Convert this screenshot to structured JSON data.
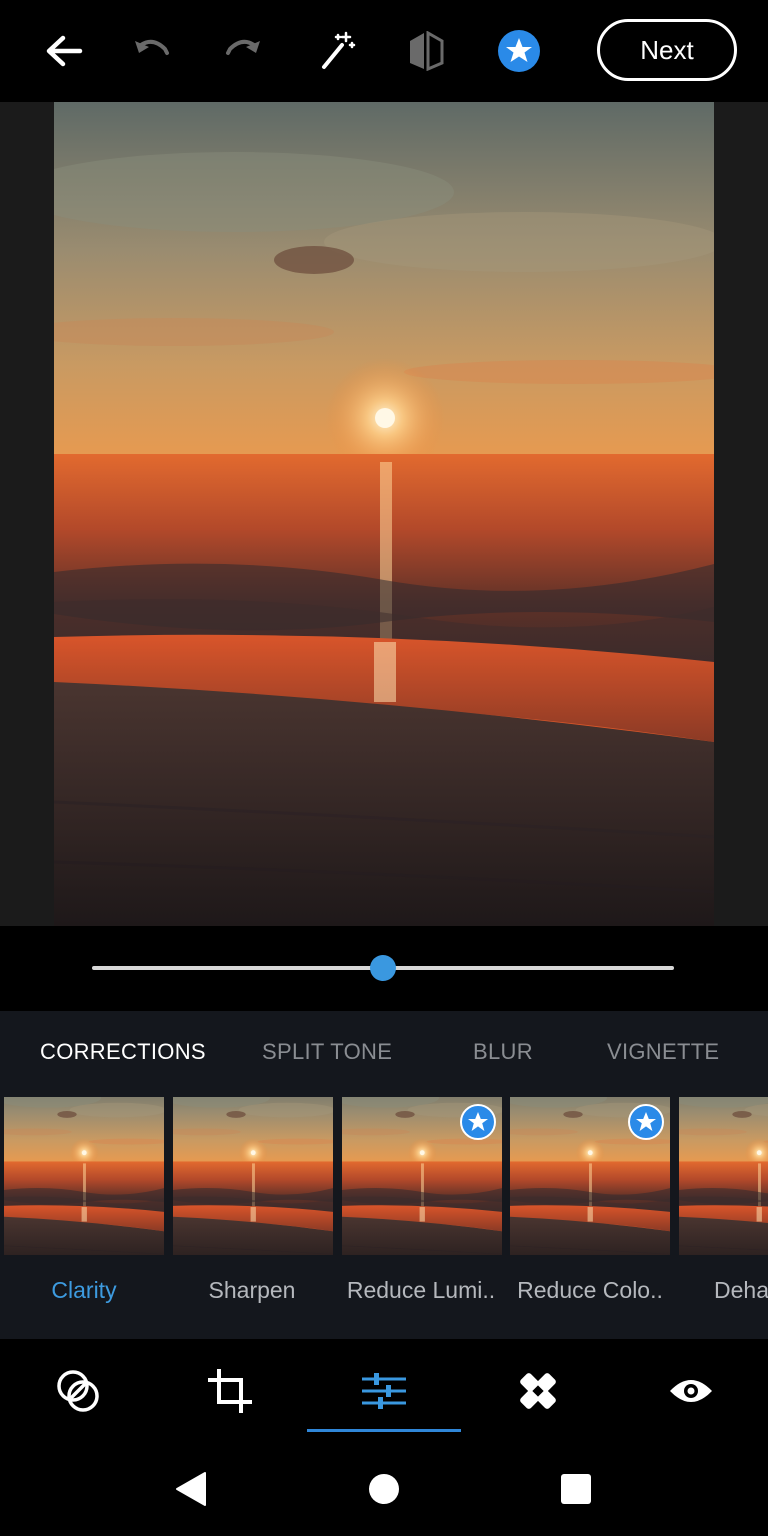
{
  "topbar": {
    "icons": [
      "back-arrow-icon",
      "undo-icon",
      "redo-icon",
      "magic-wand-icon",
      "compare-icon",
      "premium-star-icon"
    ],
    "next_label": "Next",
    "accent": "#2a8ae8"
  },
  "slider": {
    "value": 0.5
  },
  "tabs": [
    {
      "label": "CORRECTIONS",
      "active": true
    },
    {
      "label": "SPLIT TONE",
      "active": false
    },
    {
      "label": "BLUR",
      "active": false
    },
    {
      "label": "VIGNETTE",
      "active": false
    }
  ],
  "presets": [
    {
      "label": "Clarity",
      "premium": false,
      "active": true
    },
    {
      "label": "Sharpen",
      "premium": false,
      "active": false
    },
    {
      "label": "Reduce Lumi..",
      "premium": true,
      "active": false
    },
    {
      "label": "Reduce Colo..",
      "premium": true,
      "active": false
    },
    {
      "label": "Deha",
      "premium": false,
      "active": false
    }
  ],
  "tools": [
    "looks-icon",
    "crop-icon",
    "adjust-sliders-icon",
    "healing-bandage-icon",
    "eye-icon"
  ],
  "active_tool": "adjust-sliders-icon",
  "navbar": [
    "back-triangle-icon",
    "home-circle-icon",
    "recents-square-icon"
  ]
}
